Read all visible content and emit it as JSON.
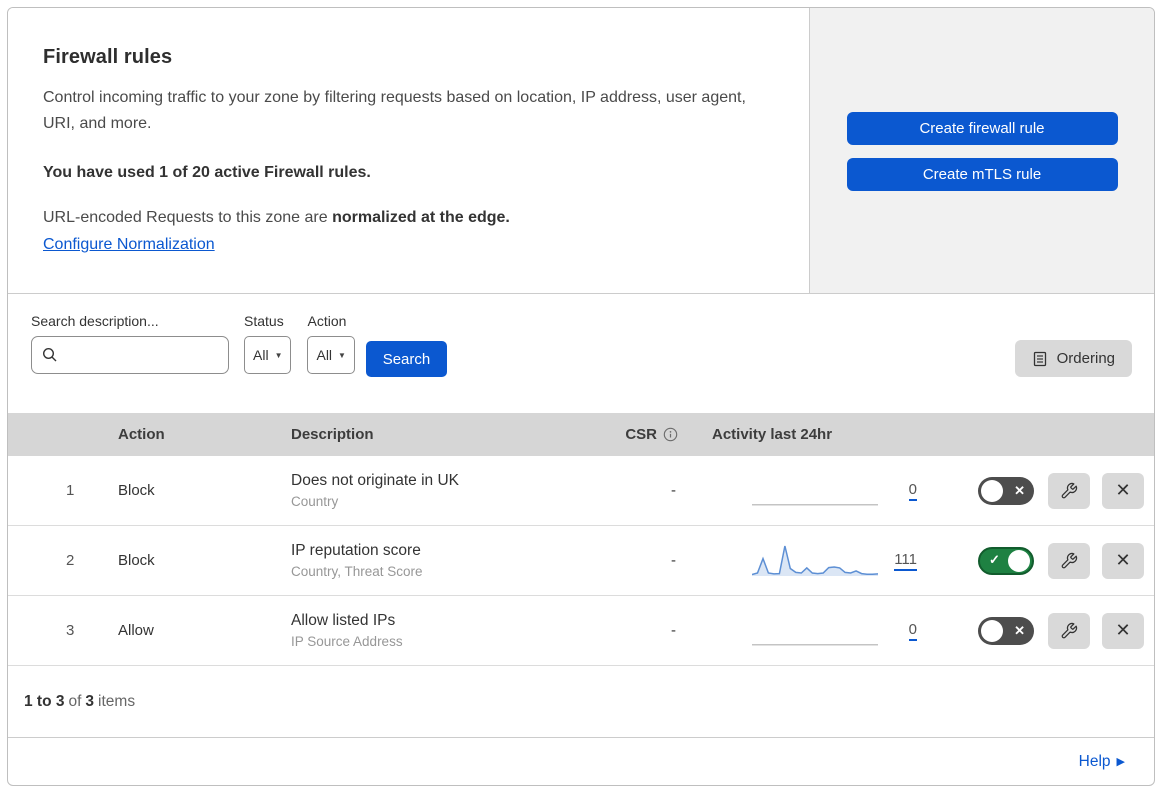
{
  "intro": {
    "title": "Firewall rules",
    "description": "Control incoming traffic to your zone by filtering requests based on location, IP address, user agent, URI, and more.",
    "usage": "You have used 1 of 20 active Firewall rules.",
    "normalization_prefix": "URL-encoded Requests to this zone are ",
    "normalization_bold": "normalized at the edge.",
    "normalization_link": "Configure Normalization"
  },
  "actions_panel": {
    "create_firewall_rule": "Create firewall rule",
    "create_mtls_rule": "Create mTLS rule"
  },
  "filters": {
    "search_label": "Search description...",
    "status_label": "Status",
    "status_value": "All",
    "action_label": "Action",
    "action_value": "All",
    "search_button": "Search",
    "ordering_button": "Ordering"
  },
  "table": {
    "headers": {
      "action": "Action",
      "description": "Description",
      "csr": "CSR",
      "activity": "Activity last 24hr"
    },
    "rows": [
      {
        "priority": "1",
        "action": "Block",
        "description": "Does not originate in UK",
        "criteria": "Country",
        "csr": "-",
        "activity_count": "0",
        "enabled": false,
        "sparkline": {
          "color": "#c4c4c4",
          "fill": null,
          "values": [
            0.04,
            0.04,
            0.04,
            0.04,
            0.04,
            0.04,
            0.04,
            0.04,
            0.04,
            0.04
          ]
        }
      },
      {
        "priority": "2",
        "action": "Block",
        "description": "IP reputation score",
        "criteria": "Country, Threat Score",
        "csr": "-",
        "activity_count": "111",
        "enabled": true,
        "sparkline": {
          "color": "#5d8fd4",
          "fill": "rgba(125,165,220,0.28)",
          "values": [
            0.05,
            0.1,
            0.58,
            0.1,
            0.07,
            0.08,
            1.0,
            0.25,
            0.12,
            0.1,
            0.27,
            0.1,
            0.08,
            0.1,
            0.28,
            0.3,
            0.27,
            0.12,
            0.1,
            0.17,
            0.08,
            0.06,
            0.06,
            0.07
          ]
        }
      },
      {
        "priority": "3",
        "action": "Allow",
        "description": "Allow listed IPs",
        "criteria": "IP Source Address",
        "csr": "-",
        "activity_count": "0",
        "enabled": false,
        "sparkline": {
          "color": "#c4c4c4",
          "fill": null,
          "values": [
            0.04,
            0.04,
            0.04,
            0.04,
            0.04,
            0.04,
            0.04,
            0.04,
            0.04,
            0.04
          ]
        }
      }
    ]
  },
  "footer": {
    "range": "1 to 3",
    "of": "of",
    "total": "3",
    "items": "items",
    "help": "Help"
  },
  "icons": {
    "dropdown_caret": "▼",
    "toggle_check": "✓",
    "toggle_x": "✕",
    "close_x": "✕",
    "help_arrow": "▶"
  },
  "colors": {
    "accent_blue": "#0b58d0",
    "toggle_on_green": "#1e8142",
    "toggle_off_gray": "#4d4d4d",
    "table_header_bg": "#d6d6d6",
    "panel_bg": "#f1f1f1",
    "sparkline_blue": "#5d8fd4"
  }
}
